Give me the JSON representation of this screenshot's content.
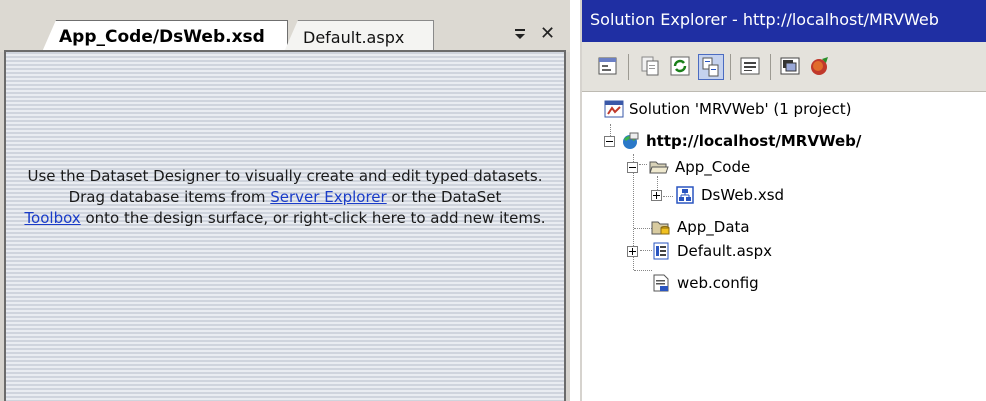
{
  "designer": {
    "tabs": [
      {
        "label": "App_Code/DsWeb.xsd",
        "active": true
      },
      {
        "label": "Default.aspx",
        "active": false
      }
    ],
    "hint": {
      "line1": "Use the Dataset Designer to visually create and edit typed datasets.",
      "part2_before": "Drag database items from ",
      "server_explorer_link": "Server Explorer",
      "part2_middle": " or the DataSet ",
      "toolbox_link": "Toolbox",
      "part2_after": " onto the design surface, or right-click here to add new items."
    }
  },
  "solution_explorer": {
    "title": "Solution Explorer - http://localhost/MRVWeb",
    "toolbar_icons": [
      "properties-icon",
      "show-all-files-icon",
      "refresh-icon",
      "nest-related-files-icon",
      "view-code-icon",
      "view-designer-icon",
      "copy-web-site-icon"
    ],
    "tree": {
      "solution": "Solution 'MRVWeb' (1 project)",
      "project": "http://localhost/MRVWeb/",
      "app_code": "App_Code",
      "dsweb": "DsWeb.xsd",
      "app_data": "App_Data",
      "default_aspx": "Default.aspx",
      "web_config": "web.config"
    }
  },
  "colors": {
    "titlebar": "#1f2fa3",
    "toolbar": "#e4e2dc",
    "link": "#1a3cc8",
    "tab_strip": "#dcd9d2"
  }
}
